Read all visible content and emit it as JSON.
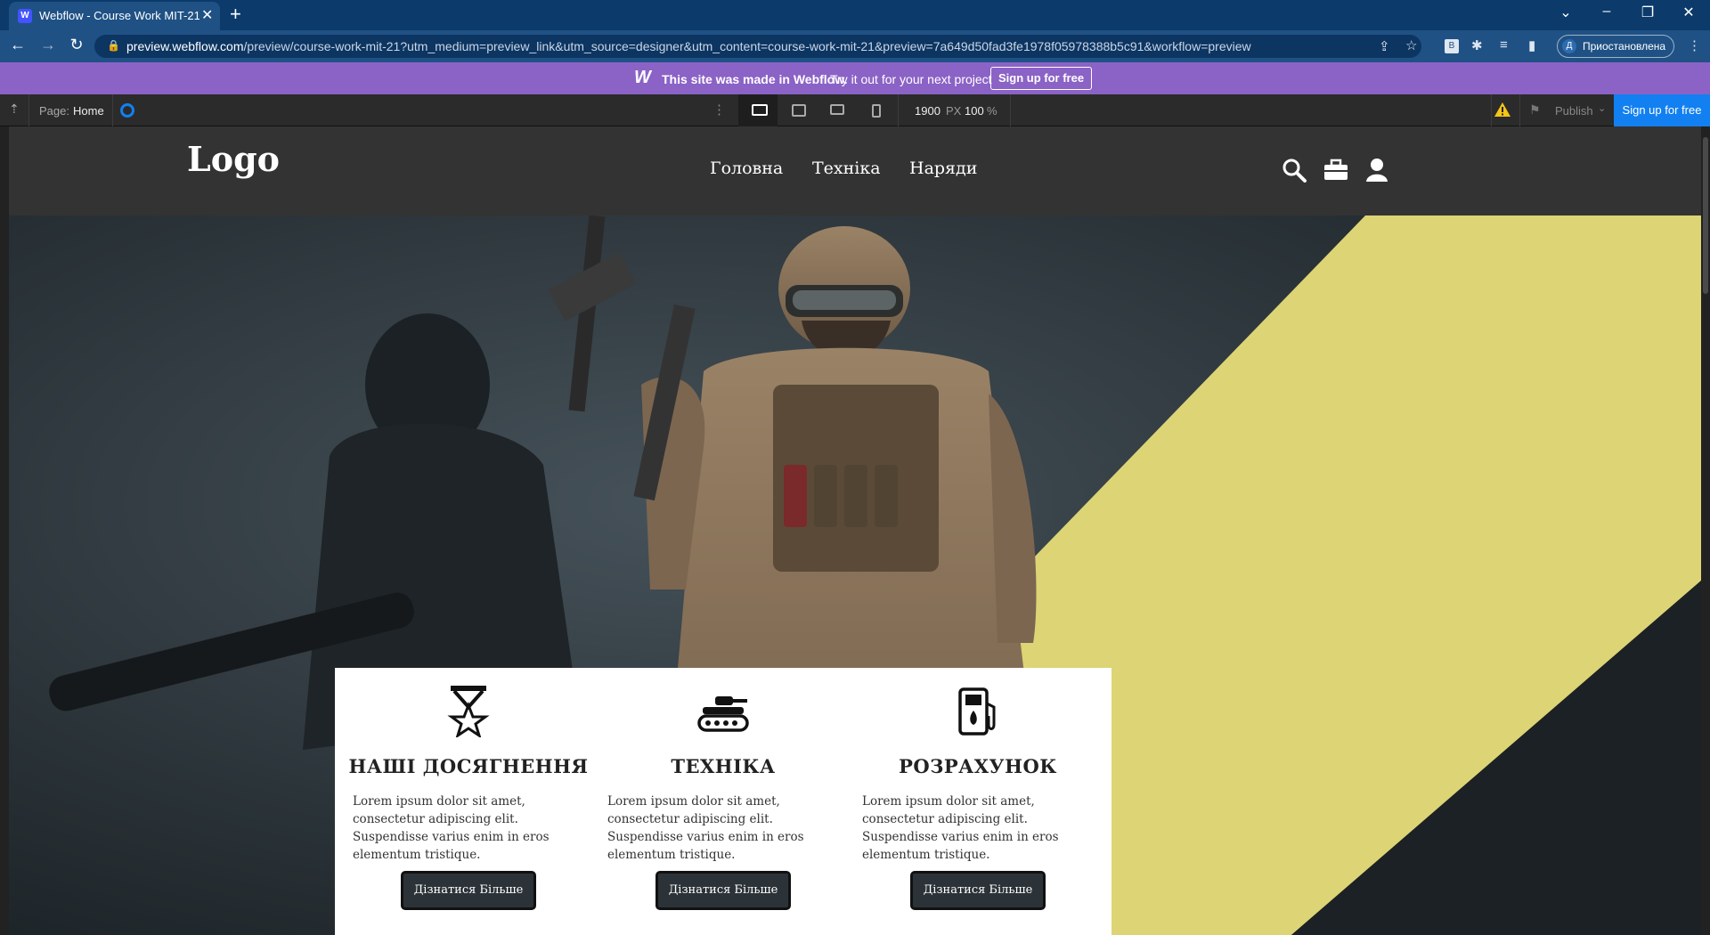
{
  "browser": {
    "tab_title": "Webflow - Course Work MIT-21",
    "tab_favicon": "W",
    "url_host": "preview.webflow.com",
    "url_path": "/preview/course-work-mit-21?utm_medium=preview_link&utm_source=designer&utm_content=course-work-mit-21&preview=7a649d50fad3fe1978f05978388b5c91&workflow=preview",
    "profile_initial": "Д",
    "profile_label": "Приостановлена"
  },
  "banner": {
    "logo": "W",
    "made_text": "This site was made in Webflow.",
    "try_text": "Try it out for your next project",
    "signup_label": "Sign up for free"
  },
  "designer": {
    "page_prefix": "Page:",
    "page_name": "Home",
    "width_value": "1900",
    "width_unit": "PX",
    "zoom": "100",
    "zoom_unit": "%",
    "publish_label": "Publish",
    "signup_label": "Sign up for free"
  },
  "site": {
    "logo": "Logo",
    "nav": [
      "Головна",
      "Техніка",
      "Наряди"
    ],
    "accent_color": "#ddd475",
    "cards": [
      {
        "icon": "medal-star-icon",
        "title": "НАШІ ДОСЯГНЕННЯ",
        "text": "Lorem ipsum dolor sit amet, consectetur adipiscing elit. Suspendisse varius enim in eros elementum tristique.",
        "button": "Дізнатися Більше"
      },
      {
        "icon": "tank-icon",
        "title": "ТЕХНІКА",
        "text": "Lorem ipsum dolor sit amet, consectetur adipiscing elit. Suspendisse varius enim in eros elementum tristique.",
        "button": "Дізнатися Більше"
      },
      {
        "icon": "fuel-station-icon",
        "title": "РОЗРАХУНОК",
        "text": "Lorem ipsum dolor sit amet, consectetur adipiscing elit. Suspendisse varius enim in eros elementum tristique.",
        "button": "Дізнатися Більше"
      }
    ]
  }
}
